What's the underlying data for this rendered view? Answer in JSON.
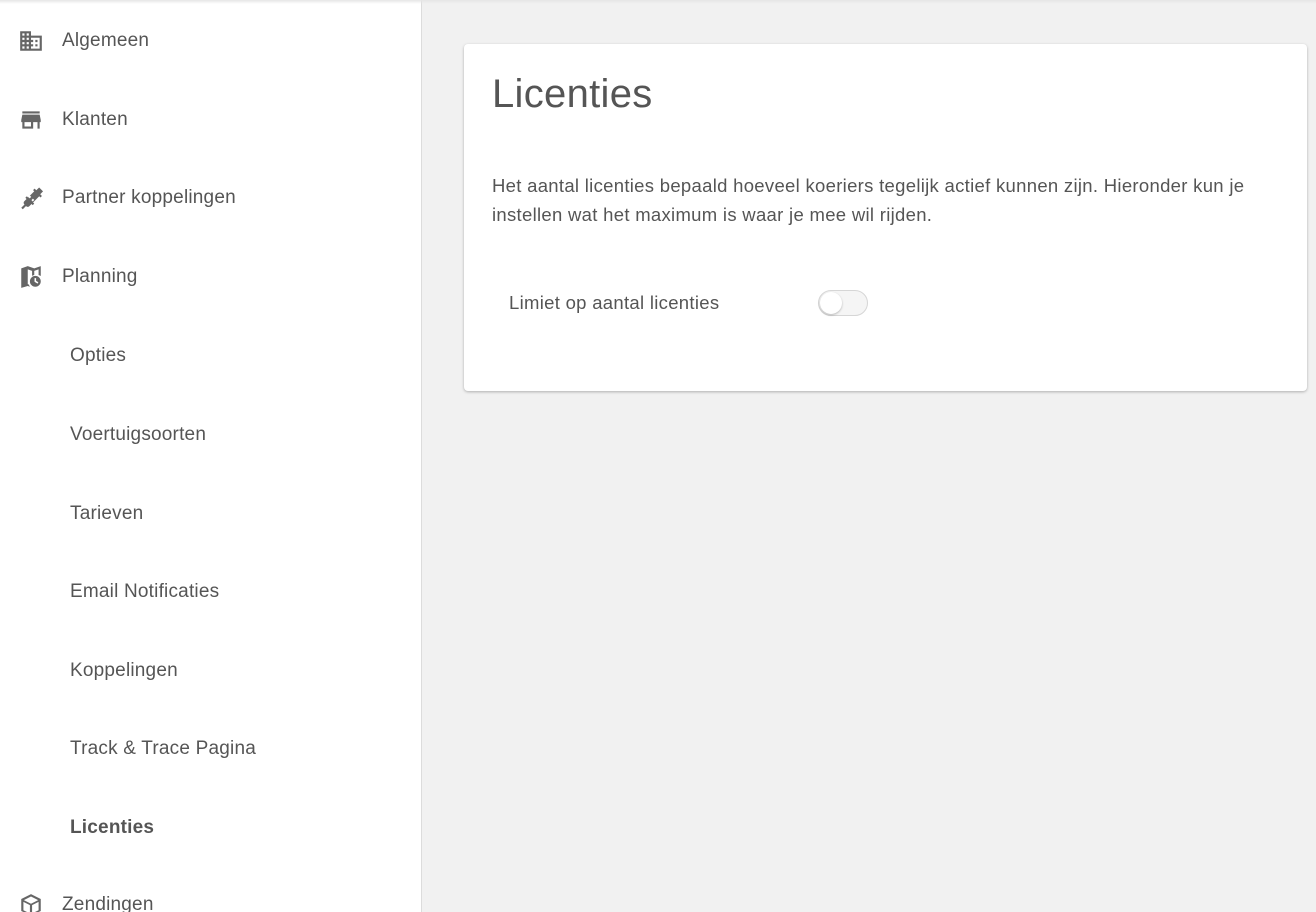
{
  "sidebar": {
    "items": [
      {
        "label": "Algemeen",
        "icon": "building-icon"
      },
      {
        "label": "Klanten",
        "icon": "store-icon"
      },
      {
        "label": "Partner koppelingen",
        "icon": "plug-icon"
      },
      {
        "label": "Planning",
        "icon": "map-clock-icon"
      },
      {
        "label": "Opties"
      },
      {
        "label": "Voertuigsoorten"
      },
      {
        "label": "Tarieven"
      },
      {
        "label": "Email Notificaties"
      },
      {
        "label": "Koppelingen"
      },
      {
        "label": "Track & Trace Pagina"
      },
      {
        "label": "Licenties",
        "active": true
      },
      {
        "label": "Zendingen",
        "icon": "package-icon"
      }
    ]
  },
  "main": {
    "title": "Licenties",
    "description": "Het aantal licenties bepaald hoeveel koeriers tegelijk actief kunnen zijn. Hieronder kun je instellen wat het maximum is waar je mee wil rijden.",
    "setting": {
      "label": "Limiet op aantal licenties",
      "enabled": false
    }
  },
  "colors": {
    "background": "#f1f1f1",
    "sidebar": "#ffffff",
    "text": "#555555",
    "icon": "#666666"
  }
}
